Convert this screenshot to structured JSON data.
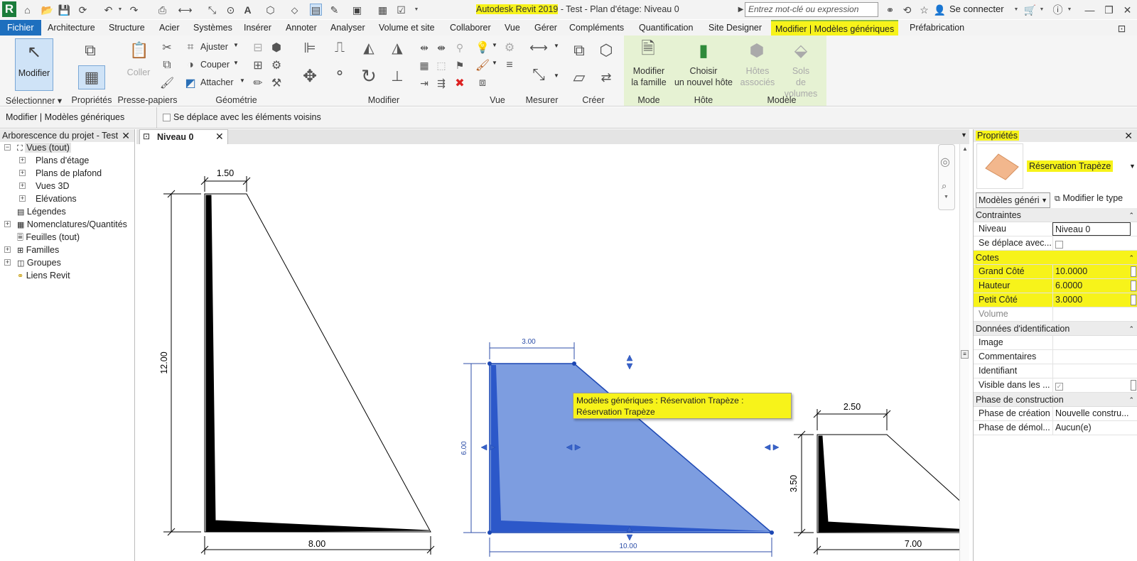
{
  "app": {
    "title": "Autodesk Revit 2019",
    "doc_title": "- Test - Plan d'étage: Niveau 0",
    "search_placeholder": "Entrez mot-clé ou expression",
    "signin": "Se connecter",
    "accent": "#1e6fbe",
    "highlight": "#f7f31a"
  },
  "tabs": [
    "Fichier",
    "Architecture",
    "Structure",
    "Acier",
    "Systèmes",
    "Insérer",
    "Annoter",
    "Analyser",
    "Volume et site",
    "Collaborer",
    "Vue",
    "Gérer",
    "Compléments",
    "Quantification",
    "Site Designer",
    "Modifier | Modèles génériques",
    "Préfabrication"
  ],
  "ribbon": {
    "modifier": "Modifier",
    "groups": {
      "selectionner": "Sélectionner",
      "proprietes": "Propriétés",
      "presse": "Presse-papiers",
      "geometrie": "Géométrie",
      "modifier": "Modifier",
      "vue": "Vue",
      "mesurer": "Mesurer",
      "creer": "Créer",
      "mode": "Mode",
      "hote": "Hôte",
      "modele": "Modèle"
    },
    "coller": "Coller",
    "ajuster": "Ajuster",
    "couper": "Couper",
    "attacher": "Attacher",
    "modifier_famille_1": "Modifier",
    "modifier_famille_2": "la famille",
    "choisir_hote_1": "Choisir",
    "choisir_hote_2": "un nouvel hôte",
    "hotes_1": "Hôtes",
    "hotes_2": "associés",
    "sols_1": "Sols",
    "sols_2": "de volumes"
  },
  "optionbar": {
    "context": "Modifier | Modèles génériques",
    "checkbox": "Se déplace avec les éléments voisins"
  },
  "browser": {
    "title": "Arborescence du projet - Test",
    "items": [
      "Vues (tout)",
      "Plans d'étage",
      "Plans de plafond",
      "Vues 3D",
      "Elévations",
      "Légendes",
      "Nomenclatures/Quantités",
      "Feuilles (tout)",
      "Familles",
      "Groupes",
      "Liens Revit"
    ]
  },
  "view": {
    "tab": "Niveau 0",
    "tooltip": "Modèles génériques : Réservation Trapèze : Réservation Trapèze",
    "dims": {
      "d1_top": "1.50",
      "d1_left": "12.00",
      "d1_bottom": "8.00",
      "d2_top": "3.00",
      "d2_left": "6.00",
      "d2_bottom": "10.00",
      "d3_top": "2.50",
      "d3_left": "3.50",
      "d3_bottom": "7.00"
    }
  },
  "properties": {
    "title": "Propriétés",
    "type_name": "Réservation Trapèze",
    "category": "Modèles généri",
    "edit_type": "Modifier le type",
    "sections": {
      "contraintes": "Contraintes",
      "cotes": "Cotes",
      "identification": "Données d'identification",
      "phase": "Phase de construction"
    },
    "rows": {
      "niveau": {
        "k": "Niveau",
        "v": "Niveau 0"
      },
      "deplace": {
        "k": "Se déplace avec...",
        "v": ""
      },
      "grand": {
        "k": "Grand Côté",
        "v": "10.0000"
      },
      "hauteur": {
        "k": "Hauteur",
        "v": "6.0000"
      },
      "petit": {
        "k": "Petit Côté",
        "v": "3.0000"
      },
      "volume": {
        "k": "Volume",
        "v": ""
      },
      "image": {
        "k": "Image",
        "v": ""
      },
      "comment": {
        "k": "Commentaires",
        "v": ""
      },
      "ident": {
        "k": "Identifiant",
        "v": ""
      },
      "visible": {
        "k": "Visible dans les ...",
        "v": ""
      },
      "creation": {
        "k": "Phase de création",
        "v": "Nouvelle constru..."
      },
      "demol": {
        "k": "Phase de démol...",
        "v": "Aucun(e)"
      }
    }
  }
}
